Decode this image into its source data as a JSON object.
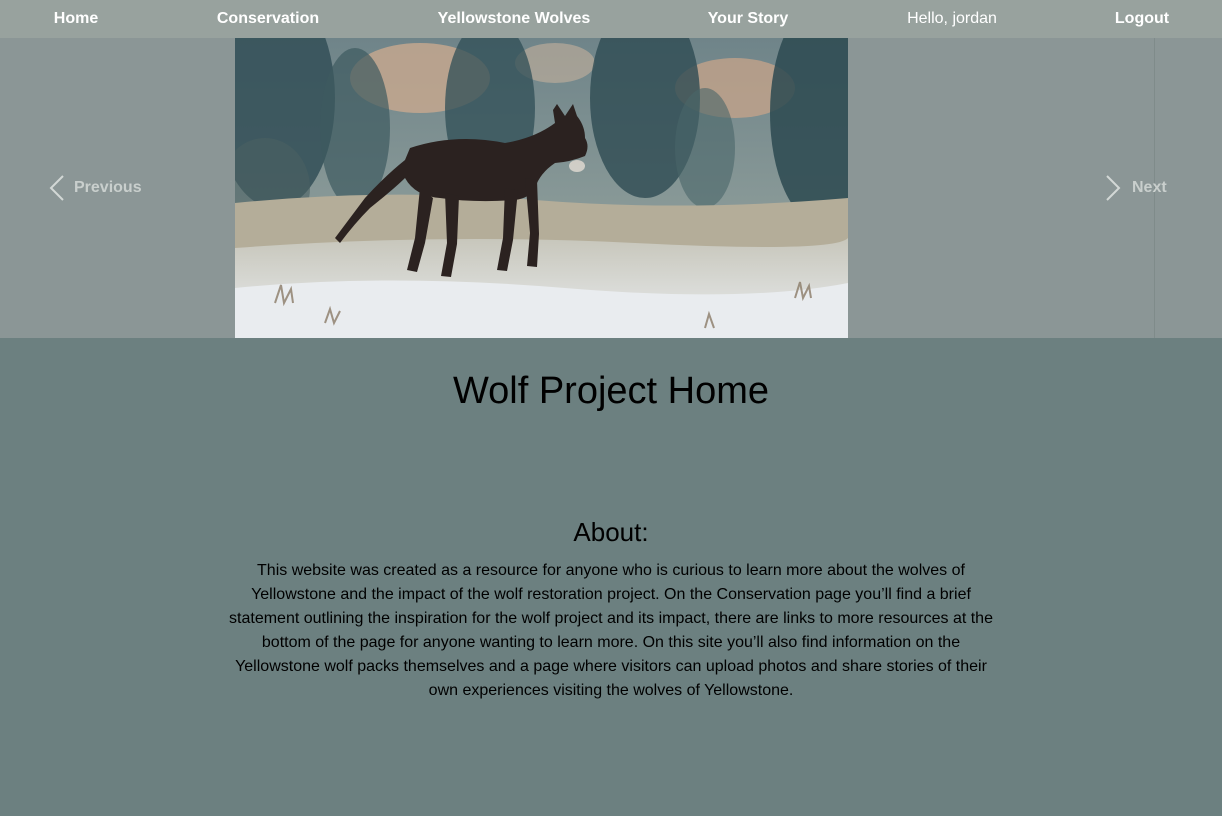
{
  "nav": {
    "home": "Home",
    "conservation": "Conservation",
    "yellowstone_wolves": "Yellowstone Wolves",
    "your_story": "Your Story",
    "greeting": "Hello, jordan",
    "logout": "Logout"
  },
  "carousel": {
    "previous_label": "Previous",
    "next_label": "Next"
  },
  "main": {
    "title": "Wolf Project Home",
    "about_heading": "About:",
    "about_text": "This website was created as a resource for anyone who is curious to learn more about the wolves of Yellowstone and the impact of the wolf restoration project. On the Conservation page you’ll find a brief statement outlining the inspiration for the wolf project and its impact, there are links to more resources at the bottom of the page for anyone wanting to learn more. On this site you’ll also find information on the Yellowstone wolf packs themselves and a page where visitors can upload photos and share stories of their own experiences visiting the wolves of Yellowstone."
  },
  "colors": {
    "navbar": "#98a29e",
    "carousel_bg": "#8b9696",
    "page_bg": "#6c8080",
    "nav_text": "#ffffff"
  }
}
